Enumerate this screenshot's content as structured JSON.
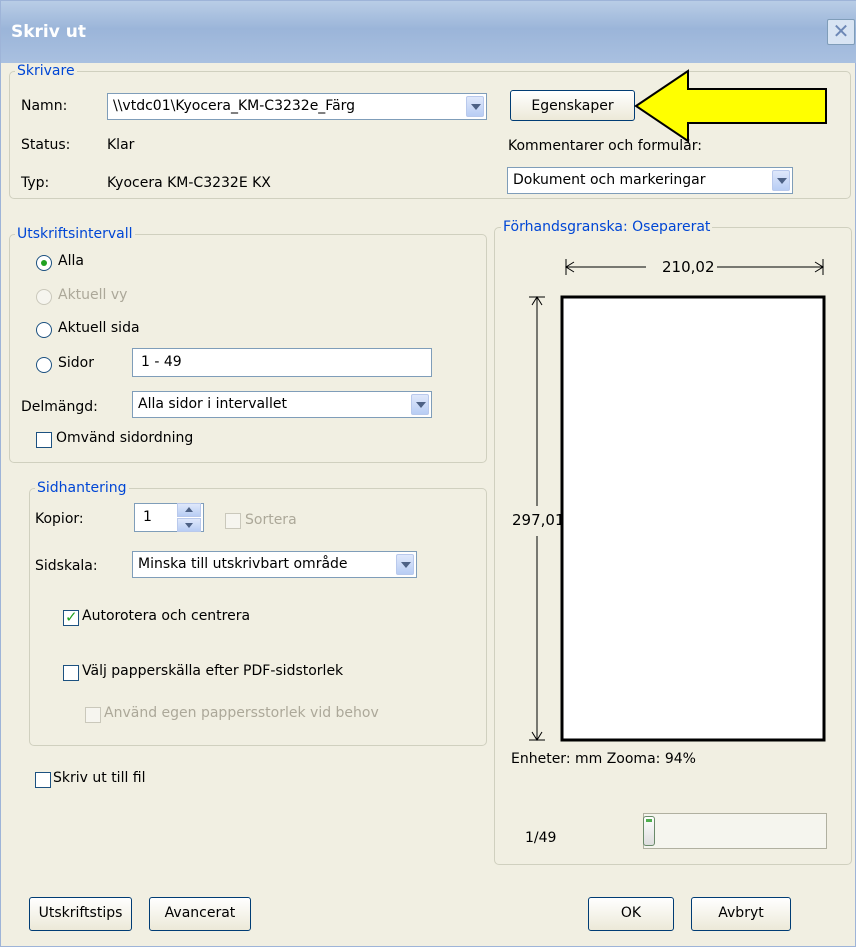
{
  "window": {
    "title": "Skriv ut",
    "close_icon": "close-icon"
  },
  "printer": {
    "legend": "Skrivare",
    "name_label": "Namn:",
    "name_value": "\\\\vtdc01\\Kyocera_KM-C3232e_Färg",
    "status_label": "Status:",
    "status_value": "Klar",
    "type_label": "Typ:",
    "type_value": "Kyocera KM-C3232E KX",
    "properties_button": "Egenskaper",
    "comments_label": "Kommentarer och formulär:",
    "comments_value": "Dokument och markeringar",
    "arrow_color": "#ffff00"
  },
  "range": {
    "legend": "Utskriftsintervall",
    "all": "Alla",
    "current_view": "Aktuell vy",
    "current_page": "Aktuell sida",
    "pages": "Sidor",
    "pages_value": "1 - 49",
    "subset_label": "Delmängd:",
    "subset_value": "Alla sidor i intervallet",
    "reverse": "Omvänd sidordning"
  },
  "handling": {
    "legend": "Sidhantering",
    "copies_label": "Kopior:",
    "copies_value": "1",
    "collate": "Sortera",
    "scale_label": "Sidskala:",
    "scale_value": "Minska till utskrivbart område",
    "autorotate": "Autorotera och centrera",
    "choose_source": "Välj papperskälla efter PDF-sidstorlek",
    "custom_size": "Använd egen pappersstorlek vid behov"
  },
  "print_to_file": "Skriv ut till fil",
  "preview": {
    "legend": "Förhandsgranska: Oseparerat",
    "width": "210,02",
    "height": "297,01",
    "units_zoom": "Enheter: mm Zooma:  94%",
    "page_counter": "1/49",
    "slider_fraction": 0
  },
  "buttons": {
    "tips": "Utskriftstips",
    "advanced": "Avancerat",
    "ok": "OK",
    "cancel": "Avbryt"
  }
}
